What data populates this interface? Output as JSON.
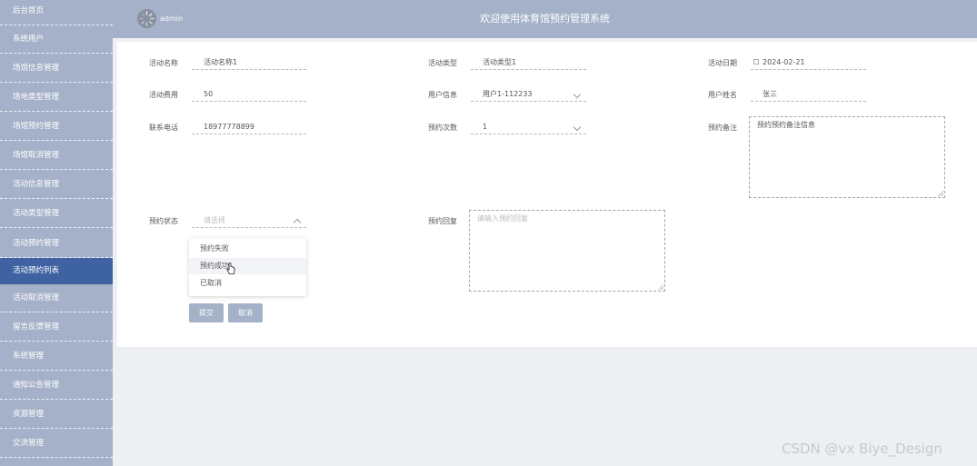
{
  "sidebar": {
    "items": [
      {
        "label": "后台首页"
      },
      {
        "label": "系统用户"
      },
      {
        "label": "场馆信息管理"
      },
      {
        "label": "场地类型管理"
      },
      {
        "label": "场馆预约管理"
      },
      {
        "label": "场馆取消管理"
      },
      {
        "label": "活动信息管理"
      },
      {
        "label": "活动类型管理"
      },
      {
        "label": "活动预约管理"
      },
      {
        "label": "活动预约列表",
        "active": true
      },
      {
        "label": "活动取消管理"
      },
      {
        "label": "留言反馈管理"
      },
      {
        "label": "系统管理"
      },
      {
        "label": "通知公告管理"
      },
      {
        "label": "资源管理"
      },
      {
        "label": "交流管理"
      }
    ]
  },
  "header": {
    "username": "admin",
    "title": "欢迎使用体育馆预约管理系统"
  },
  "form": {
    "activity_name": {
      "label": "活动名称",
      "value": "活动名称1"
    },
    "activity_type": {
      "label": "活动类型",
      "value": "活动类型1"
    },
    "activity_date": {
      "label": "活动日期",
      "value": "2024-02-21",
      "icon": "calendar-icon"
    },
    "activity_fee": {
      "label": "活动费用",
      "value": "50"
    },
    "user_info": {
      "label": "用户信息",
      "value": "用户1-112233"
    },
    "user_name": {
      "label": "用户姓名",
      "value": "张三"
    },
    "phone": {
      "label": "联系电话",
      "value": "18977778899"
    },
    "booking_count": {
      "label": "预约次数",
      "value": "1"
    },
    "booking_note": {
      "label": "预约备注",
      "value": "预约预约备注信息"
    },
    "booking_status": {
      "label": "预约状态",
      "placeholder": "请选择"
    },
    "booking_reply": {
      "label": "预约回复",
      "placeholder": "请输入预约回复"
    },
    "status_options": [
      "预约失败",
      "预约成功",
      "已取消"
    ],
    "hovered_option": "预约成功"
  },
  "buttons": {
    "submit": "提交",
    "cancel": "取消"
  },
  "watermark": "CSDN @vx Biye_Design",
  "colors": {
    "sidebar_bg": "#a4b1c8",
    "sidebar_active": "#3f63a2",
    "page_bg": "#eeeff3"
  }
}
